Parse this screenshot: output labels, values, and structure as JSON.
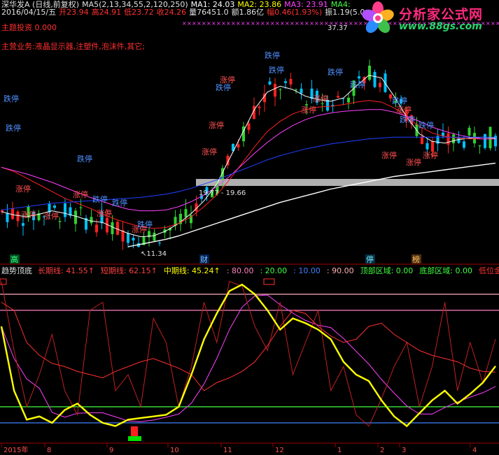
{
  "header": {
    "line1": [
      {
        "text": "深华发A (日线,前复权)",
        "color": "#e0e0e0"
      },
      {
        "text": "MA5(2,13,34,55,2,120,250)",
        "color": "#e0e0e0"
      },
      {
        "text": "MA1: 24.03",
        "color": "#ffffff"
      },
      {
        "text": "MA2: 23.86",
        "color": "#ffff00"
      },
      {
        "text": "MA3: 23.91",
        "color": "#ff40ff"
      },
      {
        "text": "MA4:",
        "color": "#40ff40"
      }
    ],
    "line2": [
      {
        "text": "2016/04/15/五",
        "color": "#e0e0e0"
      },
      {
        "text": "开23.94",
        "color": "#ff3030"
      },
      {
        "text": "高24.91",
        "color": "#ff3030"
      },
      {
        "text": "低23.72",
        "color": "#ff3030"
      },
      {
        "text": "收24.26",
        "color": "#ff3030"
      },
      {
        "text": "量76451.0",
        "color": "#e0e0e0"
      },
      {
        "text": "额1.86亿",
        "color": "#e0e0e0"
      },
      {
        "text": "幅0.46(1.93%)",
        "color": "#ff3030"
      },
      {
        "text": "振1.19(5.0",
        "color": "#e0e0e0"
      }
    ],
    "line3": "主题投资 0.000",
    "line4": "主营业务:液晶显示器,注塑件,泡沫件,其它;"
  },
  "logo": {
    "title": "分析家公式网",
    "url": "www.88gs.com"
  },
  "price_annotations": {
    "high_label": "37.37",
    "low_label": "11.34",
    "range_label": "19.77 - 19.66",
    "limit_up": "涨停",
    "limit_down": "跌停"
  },
  "markers": [
    {
      "text": "高",
      "color": "#40ff80",
      "bg": "#005020"
    },
    {
      "text": "财",
      "color": "#80c0ff",
      "bg": "#002050"
    },
    {
      "text": "停",
      "color": "#80e0ff",
      "bg": "#003040"
    },
    {
      "text": "榜",
      "color": "#ffc060",
      "bg": "#503010"
    }
  ],
  "indicator": {
    "name": "趋势顶底",
    "items": [
      {
        "text": "长期线: 41.55↑",
        "color": "#ff4040"
      },
      {
        "text": "短期线: 62.15↑",
        "color": "#ff4040"
      },
      {
        "text": "中期线: 45.24↑",
        "color": "#ffff00"
      },
      {
        "text": ": 80.00",
        "color": "#ff80c0"
      },
      {
        "text": ": 20.00",
        "color": "#40ff40"
      },
      {
        "text": ": 10.00",
        "color": "#4080ff"
      },
      {
        "text": ": 90.00",
        "color": "#ffb0b0"
      },
      {
        "text": "顶部区域: 0.00",
        "color": "#40ff40"
      },
      {
        "text": "底部区域: 0.00",
        "color": "#40ff40"
      },
      {
        "text": "低位金叉",
        "color": "#ff3030"
      }
    ]
  },
  "time_axis": [
    "2015年",
    "8",
    "9",
    "10",
    "11",
    "12",
    "1",
    "2",
    "3",
    "4"
  ],
  "colors": {
    "up": "#ff2020",
    "down": "#00c0ff",
    "green_candle": "#30d030",
    "ma_white": "#ffffff",
    "ma_pink": "#ff40ff",
    "ma_blue": "#2040ff",
    "ma_red": "#ff2020"
  },
  "chart_data": [
    {
      "type": "line",
      "title": "",
      "series": [
        {
          "name": "MA1",
          "values": [
            15.2,
            14.8,
            14.6,
            14.9,
            15.3,
            15.0,
            14.6,
            14.1,
            13.9,
            13.2,
            12.6,
            12.2,
            12.3,
            12.9,
            13.8,
            15.0,
            16.5,
            18.5,
            21.5,
            24.5,
            27.5,
            29.5,
            30.2,
            29.8,
            29.0,
            28.6,
            28.4,
            28.8,
            30.2,
            31.5,
            31.2,
            29.0,
            26.5,
            24.5,
            23.6,
            23.4,
            23.8,
            24.0,
            24.1,
            24.0
          ]
        },
        {
          "name": "MA2",
          "values": [
            20.5,
            20.0,
            19.2,
            18.4,
            17.6,
            16.8,
            16.2,
            15.6,
            14.9,
            14.3,
            13.8,
            13.4,
            13.2,
            13.3,
            13.8,
            14.6,
            15.8,
            17.2,
            19.0,
            21.0,
            23.0,
            24.8,
            26.0,
            26.9,
            27.4,
            27.7,
            27.8,
            28.0,
            28.3,
            28.5,
            28.3,
            27.6,
            26.5,
            25.4,
            24.6,
            24.2,
            24.0,
            23.9,
            23.9,
            23.9
          ]
        },
        {
          "name": "MA3",
          "values": [
            20.5,
            20.1,
            19.7,
            19.2,
            18.7,
            18.1,
            17.5,
            16.9,
            16.4,
            15.9,
            15.5,
            15.3,
            15.3,
            15.4,
            15.8,
            16.4,
            17.2,
            18.2,
            19.4,
            20.8,
            22.2,
            23.5,
            24.6,
            25.5,
            26.2,
            26.7,
            27.0,
            27.2,
            27.3,
            27.4,
            27.4,
            27.1,
            26.6,
            26.0,
            25.3,
            24.8,
            24.4,
            24.1,
            23.9,
            23.9
          ]
        },
        {
          "name": "MA4",
          "values": [
            15.4,
            15.6,
            15.8,
            16.0,
            16.2,
            16.3,
            16.4,
            16.5,
            16.6,
            16.7,
            16.8,
            16.9,
            17.1,
            17.3,
            17.6,
            18.0,
            18.5,
            19.0,
            19.6,
            20.2,
            20.8,
            21.4,
            21.9,
            22.3,
            22.7,
            23.0,
            23.3,
            23.5,
            23.7,
            23.9,
            24.0,
            24.1,
            24.1,
            24.1,
            24.1,
            24.1,
            24.1,
            24.1,
            24.1,
            24.1
          ]
        },
        {
          "name": "MA5",
          "values": [
            null,
            null,
            null,
            null,
            null,
            null,
            null,
            null,
            null,
            null,
            11.0,
            11.3,
            11.6,
            11.9,
            12.3,
            12.8,
            13.3,
            13.8,
            14.3,
            14.8,
            15.3,
            15.8,
            16.3,
            16.7,
            17.1,
            17.5,
            17.9,
            18.2,
            18.5,
            18.8,
            19.1,
            19.4,
            19.6,
            19.8,
            20.0,
            20.2,
            20.4,
            20.6,
            20.8,
            21.0
          ]
        }
      ]
    },
    {
      "type": "line",
      "title": "",
      "series": [
        {
          "name": "长期线",
          "values": [
            85,
            80,
            60,
            52,
            47,
            45,
            42,
            40,
            38,
            42,
            45,
            48,
            50,
            47,
            44,
            40,
            30,
            35,
            38,
            42,
            48,
            58,
            70,
            80,
            78,
            70,
            64,
            60,
            62,
            70,
            72,
            65,
            60,
            55,
            52,
            50,
            48,
            44,
            42,
            41.55
          ]
        },
        {
          "name": "短期线",
          "values": [
            98,
            55,
            20,
            40,
            65,
            30,
            15,
            80,
            85,
            30,
            40,
            20,
            75,
            60,
            20,
            45,
            85,
            60,
            98,
            95,
            70,
            55,
            85,
            40,
            60,
            80,
            30,
            45,
            15,
            8,
            25,
            45,
            60,
            20,
            45,
            85,
            30,
            60,
            35,
            62.15
          ]
        },
        {
          "name": "中期线",
          "values": [
            70,
            30,
            12,
            14,
            10,
            18,
            22,
            15,
            10,
            8,
            12,
            13,
            14,
            15,
            20,
            40,
            62,
            78,
            92,
            96,
            90,
            80,
            68,
            75,
            72,
            68,
            62,
            48,
            40,
            36,
            24,
            14,
            8,
            16,
            24,
            30,
            22,
            28,
            35,
            45.24
          ]
        }
      ],
      "levels": [
        80,
        20,
        10,
        90
      ]
    }
  ]
}
